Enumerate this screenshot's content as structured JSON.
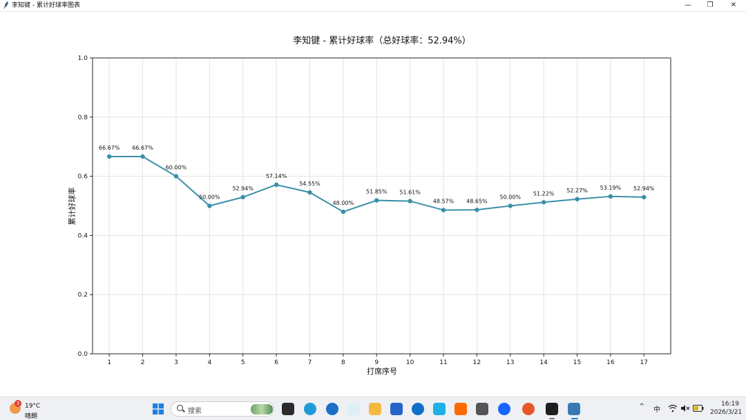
{
  "window": {
    "title": "李知键 - 累计好球率图表",
    "minimize_glyph": "—",
    "restore_glyph": "❐",
    "close_glyph": "✕"
  },
  "chart_data": {
    "type": "line",
    "title": "李知键 - 累计好球率（总好球率：52.94%）",
    "xlabel": "打席序号",
    "ylabel": "累计好球率",
    "x": [
      1,
      2,
      3,
      4,
      5,
      6,
      7,
      8,
      9,
      10,
      11,
      12,
      13,
      14,
      15,
      16,
      17
    ],
    "series": [
      {
        "values": [
          0.6667,
          0.6667,
          0.6,
          0.5,
          0.5294,
          0.5714,
          0.5455,
          0.48,
          0.5185,
          0.5161,
          0.4857,
          0.4865,
          0.5,
          0.5122,
          0.5227,
          0.5319,
          0.5294
        ],
        "labels": [
          "66.67%",
          "66.67%",
          "60.00%",
          "50.00%",
          "52.94%",
          "57.14%",
          "54.55%",
          "48.00%",
          "51.85%",
          "51.61%",
          "48.57%",
          "48.65%",
          "50.00%",
          "51.22%",
          "52.27%",
          "53.19%",
          "52.94%"
        ]
      }
    ],
    "xlim": [
      0.5,
      17.8
    ],
    "ylim": [
      0,
      1
    ],
    "yticks": [
      0,
      0.2,
      0.4,
      0.6,
      0.8,
      1.0
    ],
    "ytick_labels": [
      "0.0",
      "0.2",
      "0.4",
      "0.6",
      "0.8",
      "1.0"
    ],
    "grid": true,
    "line_color": "#3a8fa8"
  },
  "taskbar": {
    "weather": {
      "badge": "3",
      "temperature": "19°C",
      "condition": "晴朗"
    },
    "search_placeholder": "搜索",
    "tray": {
      "chevron": "^",
      "ime": "中"
    },
    "clock": {
      "time": "16:19",
      "date": "2026/3/21"
    }
  }
}
